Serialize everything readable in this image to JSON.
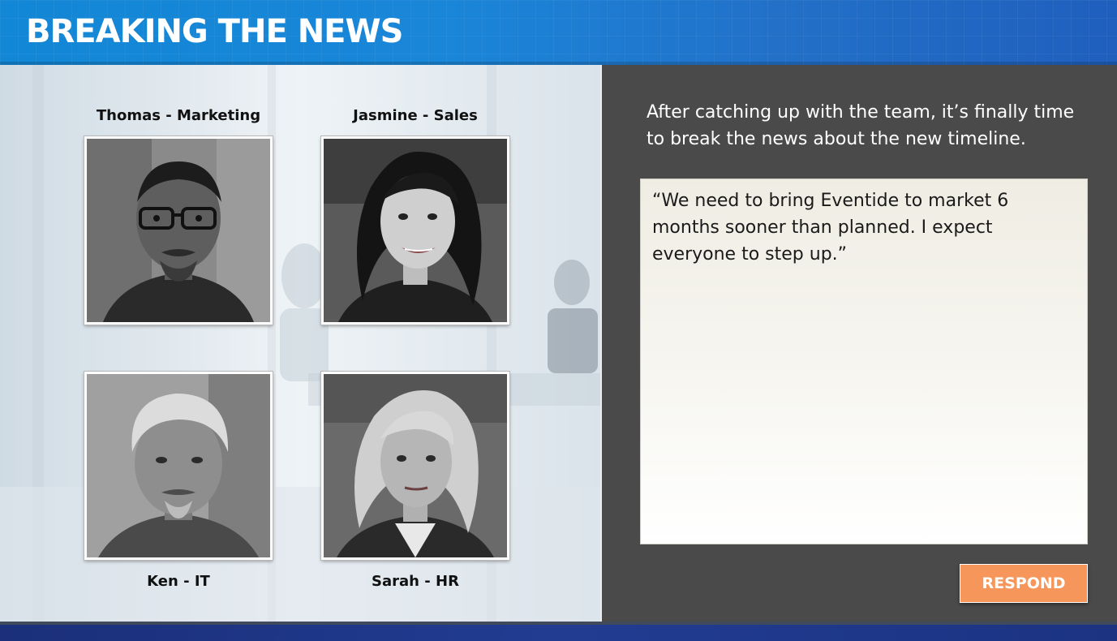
{
  "header": {
    "title": "BREAKING THE NEWS",
    "accent_color": "#1287d6"
  },
  "team": {
    "members": [
      {
        "label": "Thomas - Marketing",
        "icon": "portrait-thomas"
      },
      {
        "label": "Jasmine - Sales",
        "icon": "portrait-jasmine"
      },
      {
        "label": "Ken - IT",
        "icon": "portrait-ken"
      },
      {
        "label": "Sarah - HR",
        "icon": "portrait-sarah"
      }
    ]
  },
  "dialog": {
    "prompt": "After catching up with the team, it’s finally time to break the news about the new timeline.",
    "quote": "“We need to bring Eventide to market 6 months sooner than planned. I expect everyone to step up.”",
    "panel_color": "#4a4a4a"
  },
  "actions": {
    "respond_label": "RESPOND",
    "respond_color": "#f7965a"
  }
}
